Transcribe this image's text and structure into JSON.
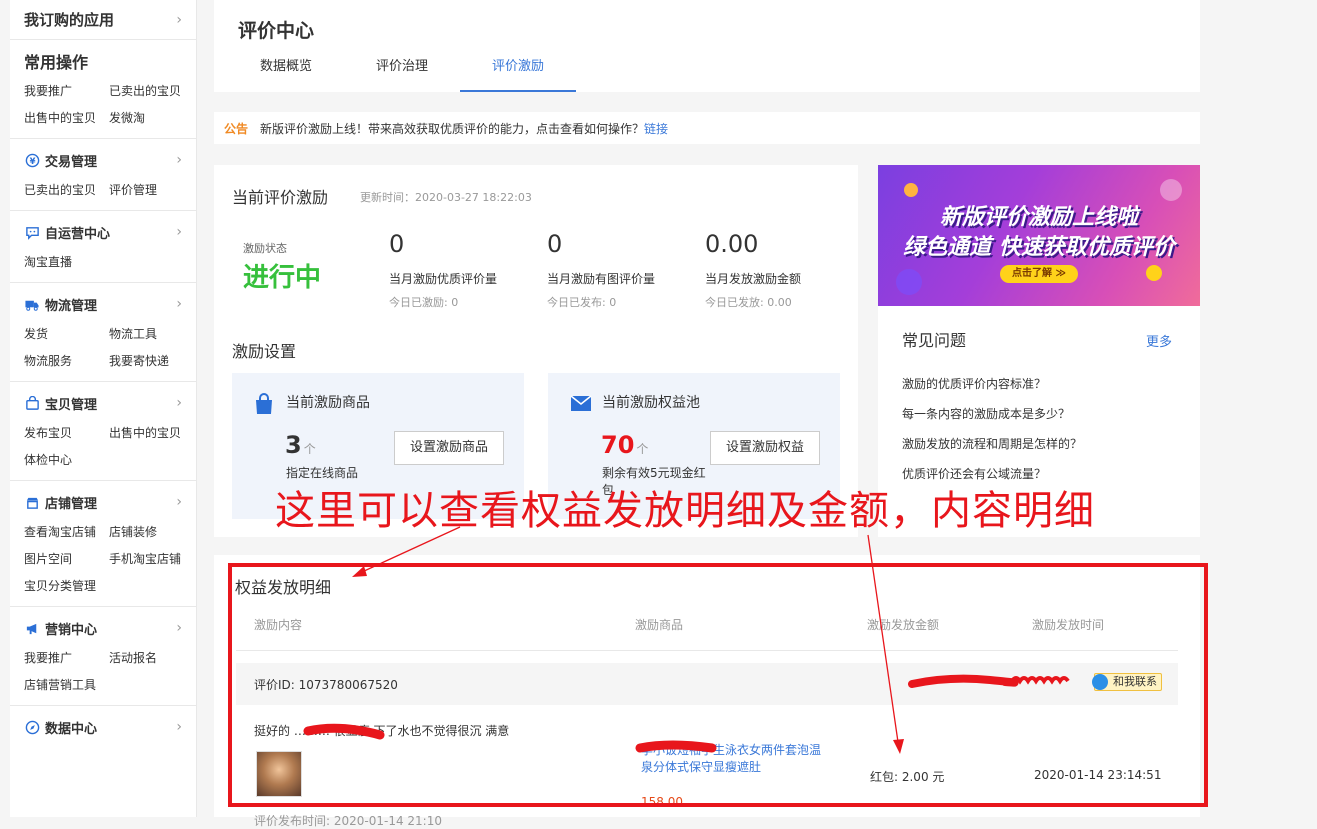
{
  "sidebar": {
    "top_label": "我订购的应用",
    "common": {
      "title": "常用操作",
      "links": [
        "我要推广",
        "已卖出的宝贝",
        "出售中的宝贝",
        "发微淘"
      ]
    },
    "groups": [
      {
        "title": "交易管理",
        "icon": "yen-icon",
        "links": [
          "已卖出的宝贝",
          "评价管理"
        ]
      },
      {
        "title": "自运营中心",
        "icon": "chat-icon",
        "links": [
          "淘宝直播"
        ]
      },
      {
        "title": "物流管理",
        "icon": "truck-icon",
        "links": [
          "发货",
          "物流工具",
          "物流服务",
          "我要寄快递"
        ]
      },
      {
        "title": "宝贝管理",
        "icon": "bag-icon",
        "links": [
          "发布宝贝",
          "出售中的宝贝",
          "体检中心"
        ]
      },
      {
        "title": "店铺管理",
        "icon": "store-icon",
        "links": [
          "查看淘宝店铺",
          "店铺装修",
          "图片空间",
          "手机淘宝店铺",
          "宝贝分类管理"
        ]
      },
      {
        "title": "营销中心",
        "icon": "megaphone-icon",
        "links": [
          "我要推广",
          "活动报名",
          "店铺营销工具"
        ]
      },
      {
        "title": "数据中心",
        "icon": "compass-icon",
        "links": []
      }
    ]
  },
  "header": {
    "title": "评价中心",
    "tabs": [
      {
        "label": "数据概览",
        "active": false
      },
      {
        "label": "评价治理",
        "active": false
      },
      {
        "label": "评价激励",
        "active": true
      }
    ]
  },
  "notice": {
    "tag": "公告",
    "message": "新版评价激励上线！带来高效获取优质评价的能力，点击查看如何操作？",
    "link": "链接"
  },
  "current": {
    "title": "当前评价激励",
    "updated": "更新时间：2020-03-27 18:22:03",
    "status_label": "激励状态",
    "status_value": "进行中",
    "stats": [
      {
        "value": "0",
        "label": "当月激励优质评价量",
        "sub": "今日已激励: 0"
      },
      {
        "value": "0",
        "label": "当月激励有图评价量",
        "sub": "今日已发布: 0"
      },
      {
        "value": "0.00",
        "label": "当月发放激励金额",
        "sub": "今日已发放: 0.00"
      }
    ],
    "settings_title": "激励设置",
    "goods_card": {
      "title": "当前激励商品",
      "count": "3",
      "unit": "个",
      "desc": "指定在线商品",
      "button": "设置激励商品"
    },
    "pool_card": {
      "title": "当前激励权益池",
      "count": "70",
      "unit": "个",
      "desc": "剩余有效5元现金红包",
      "button": "设置激励权益"
    }
  },
  "banner": {
    "line1": "新版评价激励上线啦",
    "line2": "绿色通道 快速获取优质评价",
    "button": "点击了解 ≫"
  },
  "faq": {
    "title": "常见问题",
    "more": "更多",
    "items": [
      "激励的优质评价内容标准？",
      "每一条内容的激励成本是多少？",
      "激励发放的流程和周期是怎样的？",
      "优质评价还会有公域流量？"
    ]
  },
  "detail": {
    "title": "权益发放明细",
    "columns": [
      "激励内容",
      "激励商品",
      "激励发放金额",
      "激励发放时间"
    ],
    "record": {
      "review_id": "评价ID: 1073780067520",
      "contact": "和我联系",
      "review_text": "挺好的 ……… 很显瘦 下了水也不觉得很沉 满意",
      "goods": "李小饭短袖学生泳衣女两件套泡温泉分体式保守显瘦遮肚",
      "price": "158.00",
      "amount": "红包: 2.00 元",
      "time": "2020-01-14 23:14:51",
      "below": "评价发布时间: 2020-01-14 21:10"
    }
  },
  "annotation": {
    "text": "这里可以查看权益发放明细及金额，内容明细",
    "color": "#e8161c"
  },
  "colors": {
    "accent": "#3a78d8",
    "status_green": "#36c03c",
    "highlight_red": "#e8161c",
    "notice_orange": "#f08a24",
    "pool_red": "#e8161c"
  }
}
